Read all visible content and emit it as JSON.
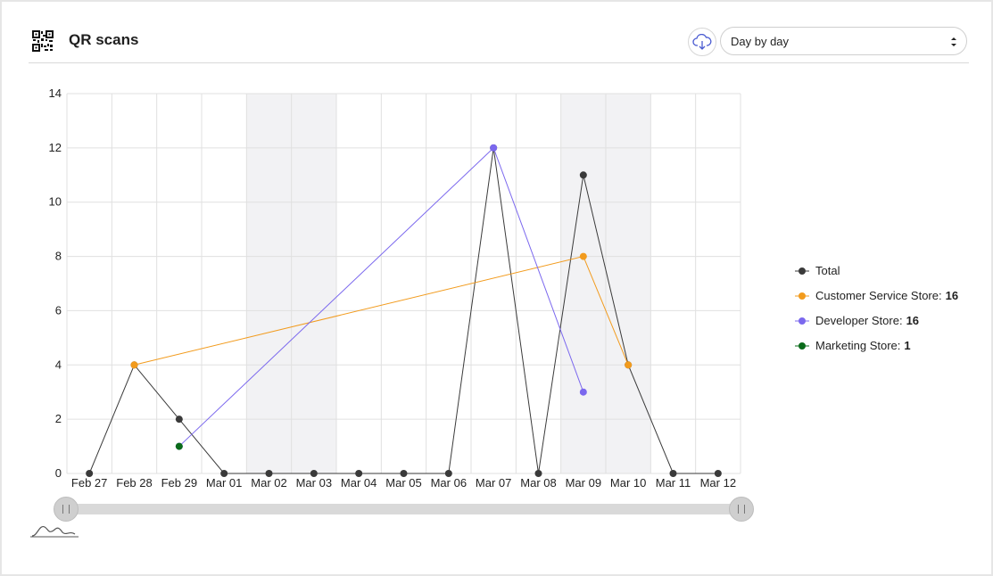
{
  "header": {
    "title": "QR scans",
    "icon": "qr-code-icon",
    "download_icon": "cloud-download-icon",
    "range_select": {
      "selected": "Day by day"
    }
  },
  "colors": {
    "total": "#3a3a3a",
    "customer_service": "#f29b1d",
    "developer": "#7b68ee",
    "marketing": "#0a6b1a",
    "weekend_band": "#f2f2f4",
    "grid": "#e0e0e0"
  },
  "chart_data": {
    "type": "line",
    "title": "",
    "xlabel": "",
    "ylabel": "",
    "ylim": [
      0,
      14
    ],
    "yticks": [
      0,
      2,
      4,
      6,
      8,
      10,
      12,
      14
    ],
    "categories": [
      "Feb 27",
      "Feb 28",
      "Feb 29",
      "Mar 01",
      "Mar 02",
      "Mar 03",
      "Mar 04",
      "Mar 05",
      "Mar 06",
      "Mar 07",
      "Mar 08",
      "Mar 09",
      "Mar 10",
      "Mar 11",
      "Mar 12"
    ],
    "weekend_bands": [
      [
        "Mar 02",
        "Mar 03"
      ],
      [
        "Mar 09",
        "Mar 10"
      ]
    ],
    "grid": true,
    "legend_position": "right",
    "series": [
      {
        "name": "Total",
        "total": "",
        "color_key": "total",
        "points": [
          {
            "x": "Feb 27",
            "y": 0
          },
          {
            "x": "Feb 28",
            "y": 4
          },
          {
            "x": "Feb 29",
            "y": 2
          },
          {
            "x": "Mar 01",
            "y": 0
          },
          {
            "x": "Mar 02",
            "y": 0
          },
          {
            "x": "Mar 03",
            "y": 0
          },
          {
            "x": "Mar 04",
            "y": 0
          },
          {
            "x": "Mar 05",
            "y": 0
          },
          {
            "x": "Mar 06",
            "y": 0
          },
          {
            "x": "Mar 07",
            "y": 12
          },
          {
            "x": "Mar 08",
            "y": 0
          },
          {
            "x": "Mar 09",
            "y": 11
          },
          {
            "x": "Mar 10",
            "y": 4
          },
          {
            "x": "Mar 11",
            "y": 0
          },
          {
            "x": "Mar 12",
            "y": 0
          }
        ]
      },
      {
        "name": "Customer Service Store:",
        "total": "16",
        "color_key": "customer_service",
        "points": [
          {
            "x": "Feb 28",
            "y": 4
          },
          {
            "x": "Mar 09",
            "y": 8
          },
          {
            "x": "Mar 10",
            "y": 4
          }
        ]
      },
      {
        "name": "Developer Store:",
        "total": "16",
        "color_key": "developer",
        "points": [
          {
            "x": "Feb 29",
            "y": 1
          },
          {
            "x": "Mar 07",
            "y": 12
          },
          {
            "x": "Mar 09",
            "y": 3
          }
        ]
      },
      {
        "name": "Marketing Store:",
        "total": "1",
        "color_key": "marketing",
        "points": [
          {
            "x": "Feb 29",
            "y": 1
          }
        ]
      }
    ]
  },
  "range_slider": {
    "left_handle": "slider-handle-left",
    "right_handle": "slider-handle-right",
    "preview_icon": "mini-chart-preview-icon"
  }
}
